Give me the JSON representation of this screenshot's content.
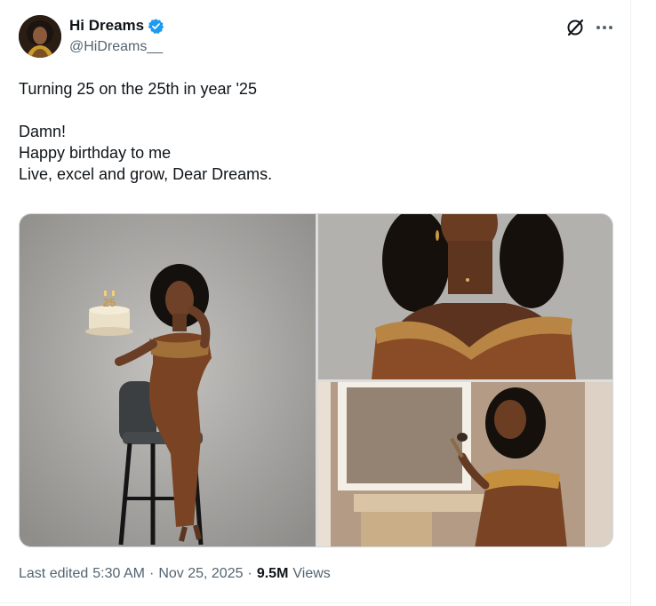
{
  "author": {
    "display_name": "Hi Dreams",
    "handle": "@HiDreams__",
    "verified": true,
    "verified_color": "#1d9bf0",
    "avatar_icon": "avatar-portrait"
  },
  "header_actions": {
    "grok_icon": "grok-icon",
    "more_icon": "more-horizontal-icon"
  },
  "tweet": {
    "lines": [
      "Turning 25 on the 25th in year '25",
      "",
      "Damn!",
      "Happy birthday to me",
      "Live, excel and grow, Dear Dreams."
    ]
  },
  "media": {
    "photos": [
      {
        "icon": "photo-woman-with-birthday-cake"
      },
      {
        "icon": "photo-woman-gold-dress-closeup"
      },
      {
        "icon": "photo-woman-makeup-vanity"
      }
    ],
    "cake_number": "25"
  },
  "meta": {
    "edited_label": "Last edited",
    "time": "5:30 AM",
    "separator": "·",
    "date": "Nov 25, 2025",
    "views_count": "9.5M",
    "views_label": "Views"
  },
  "colors": {
    "text_primary": "#0f1419",
    "text_secondary": "#536471",
    "border": "#cfd9de"
  }
}
